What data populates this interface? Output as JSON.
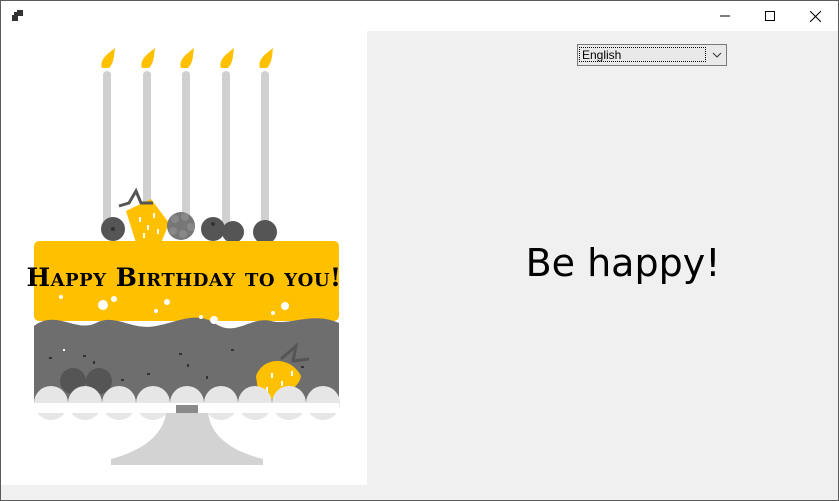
{
  "window": {
    "controls": {
      "minimize": "minimize-icon",
      "maximize": "maximize-icon",
      "close": "close-icon"
    }
  },
  "image_panel": {
    "greeting": "Happy Birthday to you!",
    "illustration": "birthday-cake-icon"
  },
  "language_select": {
    "selected": "English"
  },
  "message": "Be happy!",
  "colors": {
    "cake_yellow": "#ffc000",
    "cake_gray": "#707070",
    "plate_gray": "#d3d3d3",
    "panel_bg": "#f0f0f0"
  }
}
